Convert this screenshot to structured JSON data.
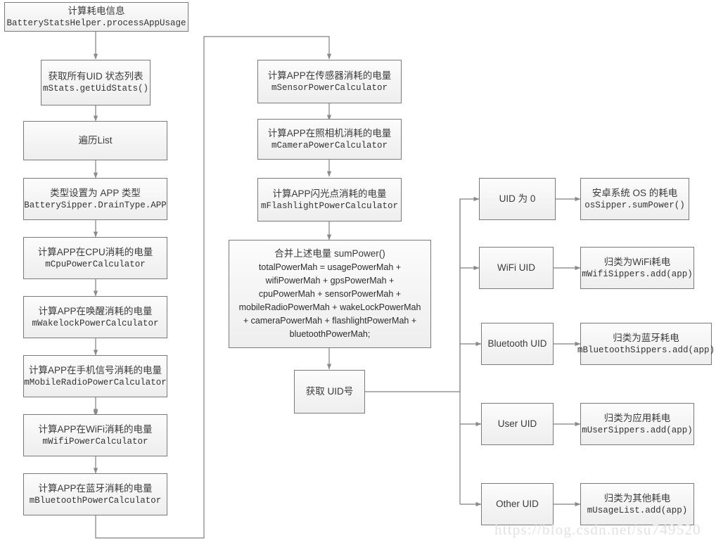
{
  "diagram": {
    "title": "Android BatteryStatsHelper processAppUsage flowchart",
    "watermark": "https://blog.csdn.net/su749520",
    "colors": {
      "box_border": "#7a7a7a",
      "box_fill": "#f4f4f4",
      "line": "#808080",
      "watermark": "#e2e2e2"
    }
  },
  "nodes": {
    "entry": {
      "cn": "计算耗电信息",
      "code": "BatteryStatsHelper.processAppUsage"
    },
    "uid_stats": {
      "cn": "获取所有UID 状态列表",
      "code": "mStats.getUidStats()"
    },
    "loop_list": {
      "cn": "遍历List",
      "code": ""
    },
    "drain_type": {
      "cn": "类型设置为 APP 类型",
      "code": "BatterySipper.DrainType.APP"
    },
    "cpu": {
      "cn": "计算APP在CPU消耗的电量",
      "code": "mCpuPowerCalculator"
    },
    "wakelock": {
      "cn": "计算APP在唤醒消耗的电量",
      "code": "mWakelockPowerCalculator"
    },
    "mobile": {
      "cn": "计算APP在手机信号消耗的电量",
      "code": "mMobileRadioPowerCalculator"
    },
    "wifi": {
      "cn": "计算APP在WiFi消耗的电量",
      "code": "mWifiPowerCalculator"
    },
    "bluetooth": {
      "cn": "计算APP在蓝牙消耗的电量",
      "code": "mBluetoothPowerCalculator"
    },
    "sensor": {
      "cn": "计算APP在传感器消耗的电量",
      "code": "mSensorPowerCalculator"
    },
    "camera": {
      "cn": "计算APP在照相机消耗的电量",
      "code": "mCameraPowerCalculator"
    },
    "flashlight": {
      "cn": "计算APP闪光点消耗的电量",
      "code": "mFlashlightPowerCalculator"
    },
    "sum_power": {
      "cn": "合并上述电量 sumPower()",
      "lines": [
        "totalPowerMah = usagePowerMah +",
        "wifiPowerMah + gpsPowerMah +",
        "cpuPowerMah + sensorPowerMah +",
        "mobileRadioPowerMah + wakeLockPowerMah",
        "+ cameraPowerMah + flashlightPowerMah +",
        "bluetoothPowerMah;"
      ]
    },
    "get_uid": {
      "cn": "获取 UID号",
      "code": ""
    },
    "uid_zero": {
      "cn": "UID 为 0",
      "code": ""
    },
    "uid_wifi": {
      "cn": "WiFi UID",
      "code": ""
    },
    "uid_bt": {
      "cn": "Bluetooth UID",
      "code": ""
    },
    "uid_user": {
      "cn": "User UID",
      "code": ""
    },
    "uid_other": {
      "cn": "Other UID",
      "code": ""
    },
    "res_os": {
      "cn": "安卓系统 OS 的耗电",
      "code": "osSipper.sumPower()"
    },
    "res_wifi": {
      "cn": "归类为WiFi耗电",
      "code": "mWifiSippers.add(app)"
    },
    "res_bt": {
      "cn": "归类为蓝牙耗电",
      "code": "mBluetoothSippers.add(app)"
    },
    "res_user": {
      "cn": "归类为应用耗电",
      "code": "mUserSippers.add(app)"
    },
    "res_other": {
      "cn": "归类为其他耗电",
      "code": "mUsageList.add(app)"
    }
  }
}
